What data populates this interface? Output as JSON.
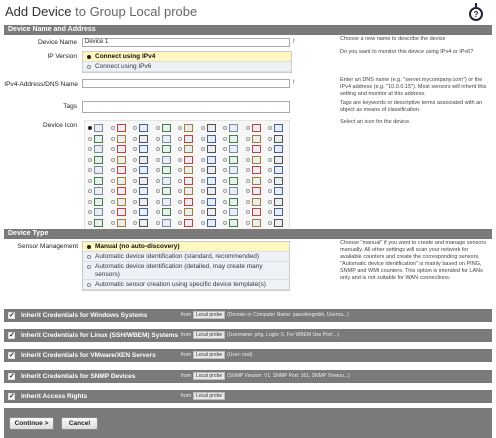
{
  "header": {
    "title_main": "Add Device",
    "title_sub": "to Group Local probe",
    "help_icon": "help-icon"
  },
  "section_name_address": {
    "heading": "Device Name and Address",
    "device_name_label": "Device Name",
    "device_name_value": "Device 1",
    "device_name_required": "!",
    "device_name_help": "Choose a new name to describe the device",
    "ip_version_label": "IP Version",
    "ip_options": [
      "Connect using IPv4",
      "Connect using IPv6"
    ],
    "ip_selected": 0,
    "ip_help": "Do you want to monitor this device using IPv4 or IPv6?",
    "address_label": "IPv4-Address/DNS Name",
    "address_value": "",
    "address_required": "!",
    "address_help": "Enter an DNS name (e.g. \"server.mycompany.com\") or the IPv4 address (e.g. \"10.0.0.15\"). Most sensors will inherit this setting and monitor at this address.",
    "tags_label": "Tags",
    "tags_value": "",
    "tags_help": "Tags are keywords or descriptive terms associated with an object as means of classification.",
    "icon_label": "Device Icon",
    "icon_help": "Select an icon for the device.",
    "icon_grid": {
      "rows": 11,
      "cols": 9,
      "selected_row": 0,
      "selected_col": 0
    }
  },
  "section_device_type": {
    "heading": "Device Type",
    "label": "Sensor Management",
    "options": [
      "Manual (no auto-discovery)",
      "Automatic device identification (standard, recommended)",
      "Automatic device identification (detailed, may create many sensors)",
      "Automatic sensor creation using specific device template(s)"
    ],
    "selected": 0,
    "help": "Choose \"manual\" if you want to create and manage sensors manually. All other settings will scan your network for available counters and create the corresponding sensors. \"Automatic device identification\" is mainly based on PING, SNMP and WMI counters. This option is intended for LANs only and is not suitable for WAN connections."
  },
  "credentials": [
    {
      "label": "Inherit Credentials for Windows Systems",
      "from": "from",
      "probe": "Local probe",
      "detail": "(Domain or Computer Name: paesslergmbh, Userna...)"
    },
    {
      "label": "Inherit Credentials for Linux (SSH/WBEM) Systems",
      "from": "from",
      "probe": "Local probe",
      "detail": "(Username: prtg, Login: 0, For WBEM Use Port:...)"
    },
    {
      "label": "Inherit Credentials for VMware/XEN Servers",
      "from": "from",
      "probe": "Local probe",
      "detail": "(User: root)"
    },
    {
      "label": "Inherit Credentials for SNMP Devices",
      "from": "from",
      "probe": "Local probe",
      "detail": "(SNMP Version: V1, SNMP Port: 161, SNMP Timeou...)"
    },
    {
      "label": "Inherit Access Rights",
      "from": "from",
      "probe": "Local probe",
      "detail": ""
    }
  ],
  "footer": {
    "continue_label": "Continue >",
    "cancel_label": "Cancel"
  }
}
